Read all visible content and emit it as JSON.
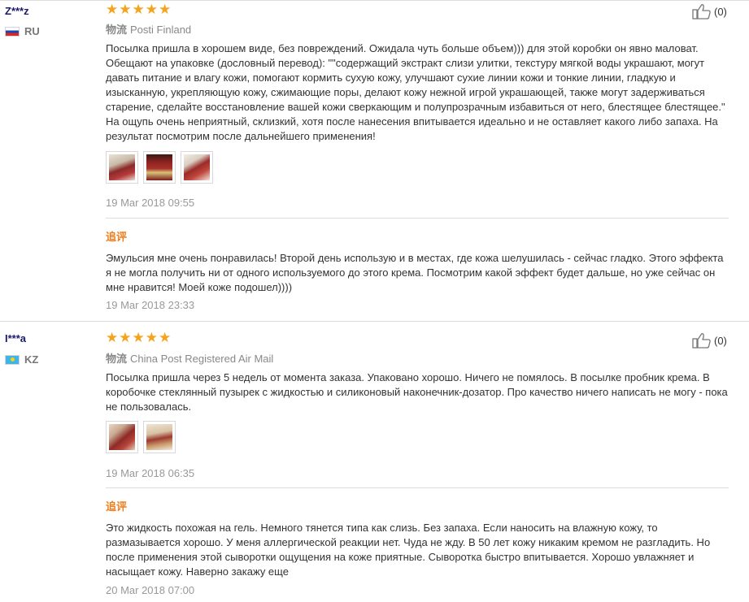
{
  "reviews": [
    {
      "user": "Z***z",
      "country_code": "RU",
      "flag": "ru-flag",
      "stars": "★★★★★",
      "rating": 5,
      "shipping_label": "物流",
      "shipping_method": "Posti Finland",
      "text": "Посылка пришла в хорошем виде, без повреждений. Ожидала чуть больше объем))) для этой коробки он явно маловат. Обещают на упаковке (дословный перевод): \"\"содержащий экстракт слизи улитки, текстуру мягкой воды украшают, могут давать питание и влагу кожи, помогают кормить сухую кожу, улучшают сухие линии кожи и тонкие линии, гладкую и изысканную, укрепляющую кожу, сжимающие поры, делают кожу нежной игрой украшающей, также могут задерживаться старение, сделайте восстановление вашей кожи сверкающим и полупрозрачным избавиться от него, блестящее блестящее.\" На ощупь очень неприятный, склизкий, хотя после нанесения впитывается идеально и не оставляет какого либо запаха. На результат посмотрим после дальнейшего применения!",
      "photos": [
        "product-photo-1",
        "product-photo-2",
        "product-photo-3"
      ],
      "date": "19 Mar 2018 09:55",
      "followup_label": "追评",
      "followup_text": "Эмульсия мне очень понравилась! Второй день использую и в местах, где кожа шелушилась - сейчас гладко. Этого эффекта я не могла получить ни от одного используемого до этого крема. Посмотрим какой эффект будет дальше, но уже сейчас он мне нравится! Моей коже подошел))))",
      "followup_date": "19 Mar 2018 23:33",
      "helpful": "(0)"
    },
    {
      "user": "I***a",
      "country_code": "KZ",
      "flag": "kz-flag",
      "stars": "★★★★★",
      "rating": 5,
      "shipping_label": "物流",
      "shipping_method": "China Post Registered Air Mail",
      "text": "Посылка пришла через 5 недель от момента заказа. Упаковано хорошо. Ничего не помялось. В посылке пробник крема. В коробочке стеклянный пузырек с жидкостью и силиконовый наконечник-дозатор. Про качество ничего написать не могу - пока не пользовалась.",
      "photos": [
        "product-photo-1",
        "product-photo-2"
      ],
      "date": "19 Mar 2018 06:35",
      "followup_label": "追评",
      "followup_text": "Это жидкость похожая на гель. Немного тянется типа как слизь. Без запаха. Если наносить на влажную кожу, то размазывается хорошо. У меня аллергической реакции нет. Чуда не жду. В 50 лет кожу никаким кремом не разгладить. Но после применения этой сыворотки ощущения на коже приятные. Сыворотка быстро впитывается. Хорошо увлажняет и насыщает кожу. Наверно закажу еще",
      "followup_date": "20 Mar 2018 07:00",
      "helpful": "(0)"
    }
  ],
  "icons": {
    "like": "thumbs-up-icon",
    "star": "star-icon"
  },
  "colors": {
    "star": "#f7a21b",
    "followup": "#f07c1b",
    "username": "#1a1a6e",
    "meta": "#999999"
  }
}
